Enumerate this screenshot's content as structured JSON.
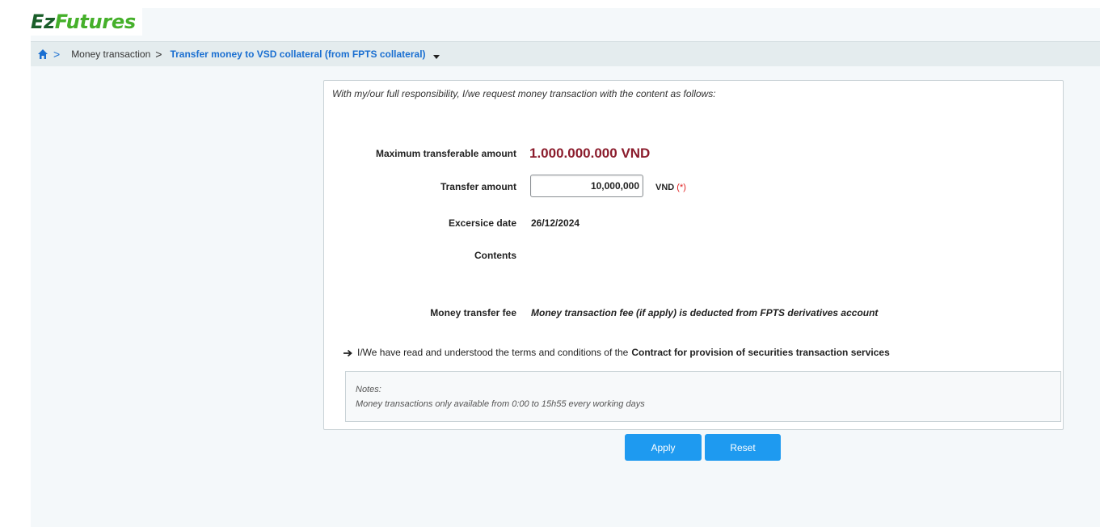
{
  "app": {
    "logo_prefix": "Ez",
    "logo_suffix": "Futures"
  },
  "breadcrumb": {
    "items": [
      "Money transaction"
    ],
    "current": "Transfer money to VSD collateral (from FPTS collateral)",
    "separator": ">"
  },
  "form": {
    "intro": "With my/our full responsibility, I/we request money transaction with the content as follows:",
    "max_label": "Maximum transferable amount",
    "max_value": "1.000.000.000 VND",
    "amount_label": "Transfer amount",
    "amount_value": "10,000,000",
    "amount_unit": "VND",
    "required_mark": "(*)",
    "date_label": "Excersice date",
    "date_value": "26/12/2024",
    "contents_label": "Contents",
    "contents_value": "",
    "fee_label": "Money transfer fee",
    "fee_value": "Money transaction fee (if apply) is deducted from FPTS derivatives account",
    "terms_text": "I/We have read and understood the terms and conditions of the",
    "terms_link": "Contract for provision of securities transaction services",
    "notes_title": "Notes:",
    "notes_text": "Money transactions only available from 0:00 to 15h55 every working days"
  },
  "buttons": {
    "apply": "Apply",
    "reset": "Reset"
  },
  "colors": {
    "accent": "#1e9af0",
    "amount_highlight": "#8b1c2c",
    "logo_dark": "#1a5e2a",
    "logo_light": "#45b02a",
    "required": "#e02020"
  },
  "icons": [
    "home-icon",
    "chevron-right-icon",
    "caret-down-icon",
    "arrow-right-icon"
  ]
}
